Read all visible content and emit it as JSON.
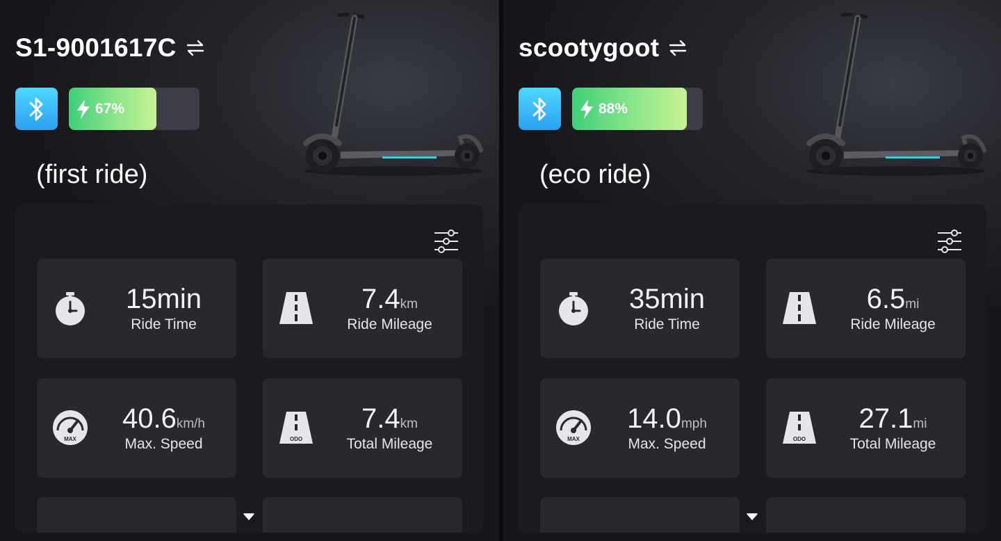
{
  "panels": [
    {
      "device_name": "S1-9001617C",
      "battery_percent": 67,
      "battery_label": "67%",
      "ride_label": "(first ride)",
      "stats": {
        "ride_time": {
          "value": "15min",
          "unit": "",
          "label": "Ride Time"
        },
        "ride_mileage": {
          "value": "7.4",
          "unit": "km",
          "label": "Ride Mileage"
        },
        "max_speed": {
          "value": "40.6",
          "unit": "km/h",
          "label": "Max. Speed"
        },
        "total_mileage": {
          "value": "7.4",
          "unit": "km",
          "label": "Total Mileage"
        }
      }
    },
    {
      "device_name": "scootygoot",
      "battery_percent": 88,
      "battery_label": "88%",
      "ride_label": "(eco ride)",
      "stats": {
        "ride_time": {
          "value": "35min",
          "unit": "",
          "label": "Ride Time"
        },
        "ride_mileage": {
          "value": "6.5",
          "unit": "mi",
          "label": "Ride Mileage"
        },
        "max_speed": {
          "value": "14.0",
          "unit": "mph",
          "label": "Max. Speed"
        },
        "total_mileage": {
          "value": "27.1",
          "unit": "mi",
          "label": "Total Mileage"
        }
      }
    }
  ],
  "icons": {
    "swap": "swap-arrows-icon",
    "bluetooth": "bluetooth-icon",
    "battery_bolt": "lightning-icon",
    "settings": "sliders-icon",
    "ride_time": "stopwatch-icon",
    "ride_mileage": "road-icon",
    "max_speed": "speedometer-icon",
    "total_mileage": "odometer-road-icon",
    "expand": "caret-down-icon"
  },
  "icon_text": {
    "max": "MAX",
    "odo": "ODO"
  },
  "colors": {
    "bluetooth_gradient_top": "#4fd7ff",
    "bluetooth_gradient_bottom": "#2c9ff0",
    "battery_fill_start": "#3fcf7a",
    "battery_fill_end": "#c6f294",
    "card_bg": "#1b1b1f",
    "tile_bg": "#28282d",
    "accent_light": "#2fd3e6"
  }
}
